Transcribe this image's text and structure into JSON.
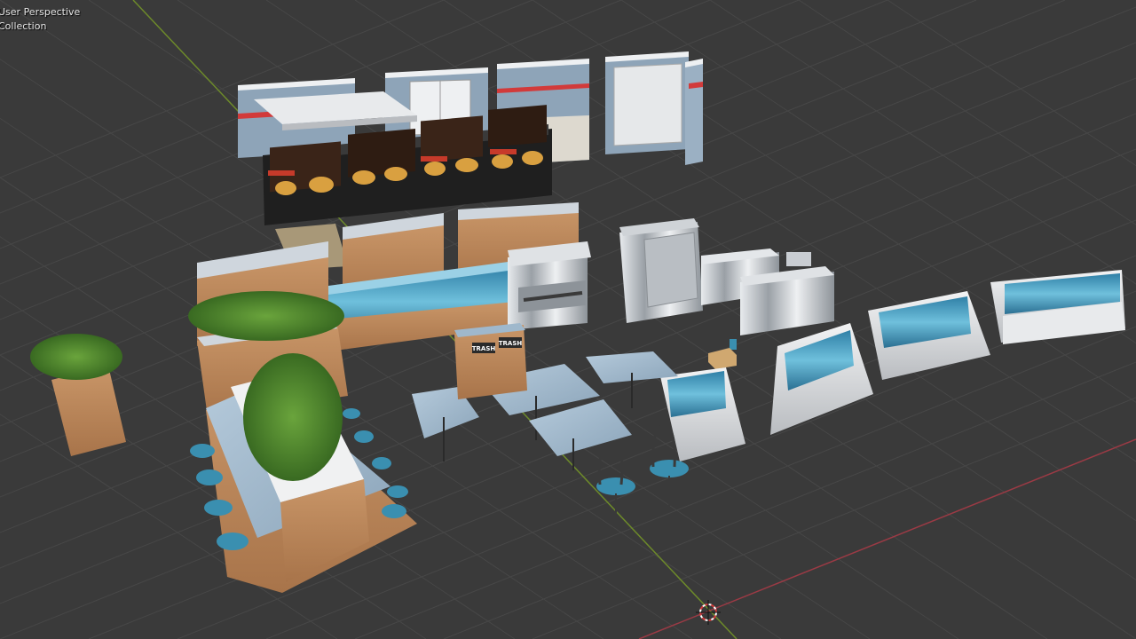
{
  "viewport": {
    "view_mode_label": "User Perspective",
    "collection_label": "Collection"
  },
  "scene": {
    "trash_label": "TRASH",
    "colors": {
      "background": "#3a3a3a",
      "grid": "#454545",
      "x_axis": "#9b3a45",
      "y_axis": "#6d8a2a",
      "wall": "#8ea4b8",
      "stripe": "#d23a3a",
      "wood": "#b8845a",
      "teal": "#3a8fb0",
      "steel": "#c9cdd2",
      "tabletop": "#9fb8cc",
      "plant": "#4f8a2e",
      "booth": "#e8eaec"
    }
  }
}
